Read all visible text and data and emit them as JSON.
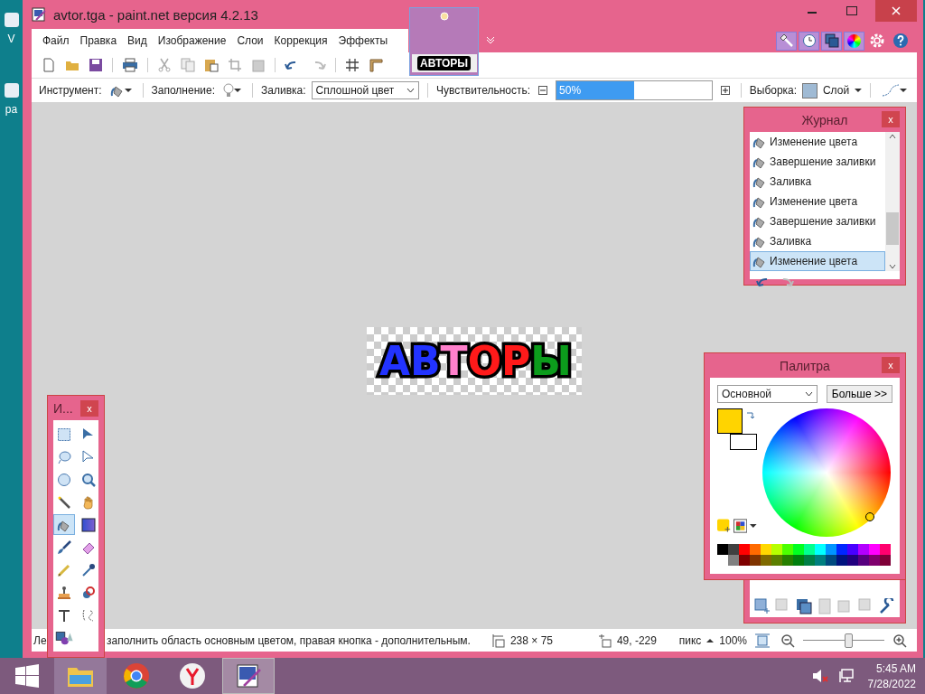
{
  "desktop": {
    "icons": [
      {
        "label": "V"
      },
      {
        "label": "ра"
      }
    ]
  },
  "window": {
    "title": "avtor.tga - paint.net версия 4.2.13"
  },
  "menu": [
    "Файл",
    "Правка",
    "Вид",
    "Изображение",
    "Слои",
    "Коррекция",
    "Эффекты"
  ],
  "image_tab": {
    "text": "АВТОРЫ",
    "selected": true
  },
  "panel_toggles": [
    {
      "kind": "tools",
      "on": true
    },
    {
      "kind": "history",
      "on": true
    },
    {
      "kind": "layers",
      "on": true
    },
    {
      "kind": "colors",
      "on": true
    }
  ],
  "tool_options": {
    "tool_label": "Инструмент:",
    "fill_label": "Заполнение:",
    "flood_label": "Заливка:",
    "flood_value": "Сплошной цвет",
    "tolerance_label": "Чувствительность:",
    "tolerance": {
      "level": 0.5,
      "reading": "50%"
    },
    "selection_label": "Выборка:",
    "selection_value": "Слой"
  },
  "canvas_image": {
    "letters": [
      {
        "text": "А",
        "color": "#2233ff"
      },
      {
        "text": "В",
        "color": "#2233ff"
      },
      {
        "text": "Т",
        "color": "#ff80cc"
      },
      {
        "text": "О",
        "color": "#ff1a1a"
      },
      {
        "text": "Р",
        "color": "#ff1a1a"
      },
      {
        "text": "Ы",
        "color": "#0c9c1c"
      }
    ]
  },
  "history": {
    "title": "Журнал",
    "close": "x",
    "items": [
      {
        "label": "Изменение цвета",
        "selected": false
      },
      {
        "label": "Завершение заливки",
        "selected": false
      },
      {
        "label": "Заливка",
        "selected": false
      },
      {
        "label": "Изменение цвета",
        "selected": false
      },
      {
        "label": "Завершение заливки",
        "selected": false
      },
      {
        "label": "Заливка",
        "selected": false
      },
      {
        "label": "Изменение цвета",
        "selected": true
      }
    ]
  },
  "palette": {
    "title": "Палитра",
    "close": "x",
    "mode": "Основной",
    "more_button": "Больше >>"
  },
  "tools": {
    "title": "И...",
    "close": "x",
    "items": [
      {
        "kind": "rect-select",
        "selected": false
      },
      {
        "kind": "move-pixels",
        "selected": false
      },
      {
        "kind": "lasso",
        "selected": false
      },
      {
        "kind": "move-selection",
        "selected": false
      },
      {
        "kind": "ellipse-select",
        "selected": false
      },
      {
        "kind": "zoom",
        "selected": false
      },
      {
        "kind": "magic-wand",
        "selected": false
      },
      {
        "kind": "pan",
        "selected": false
      },
      {
        "kind": "bucket",
        "selected": true
      },
      {
        "kind": "gradient",
        "selected": false
      },
      {
        "kind": "brush",
        "selected": false
      },
      {
        "kind": "eraser",
        "selected": false
      },
      {
        "kind": "pencil",
        "selected": false
      },
      {
        "kind": "picker",
        "selected": false
      },
      {
        "kind": "stamp",
        "selected": false
      },
      {
        "kind": "recolor",
        "selected": false
      },
      {
        "kind": "text",
        "selected": false
      },
      {
        "kind": "line",
        "selected": false
      },
      {
        "kind": "shapes",
        "selected": false
      }
    ]
  },
  "status_bar": {
    "hint_start": "Ле",
    "hint_end": "заполнить область основным цветом, правая кнопка - дополнительным.",
    "size": "238 × 75",
    "position": "49, -229",
    "units": "пикс",
    "zoom": "100%",
    "zoom_slider": {
      "level": 0.55
    }
  },
  "taskbar": {
    "apps": [
      {
        "kind": "folder",
        "running": true,
        "selected": false
      },
      {
        "kind": "chrome",
        "running": false,
        "selected": false
      },
      {
        "kind": "yandex",
        "running": false,
        "selected": false
      },
      {
        "kind": "paint",
        "running": true,
        "selected": true
      }
    ],
    "time": "5:45 AM",
    "date": "7/28/2022"
  }
}
